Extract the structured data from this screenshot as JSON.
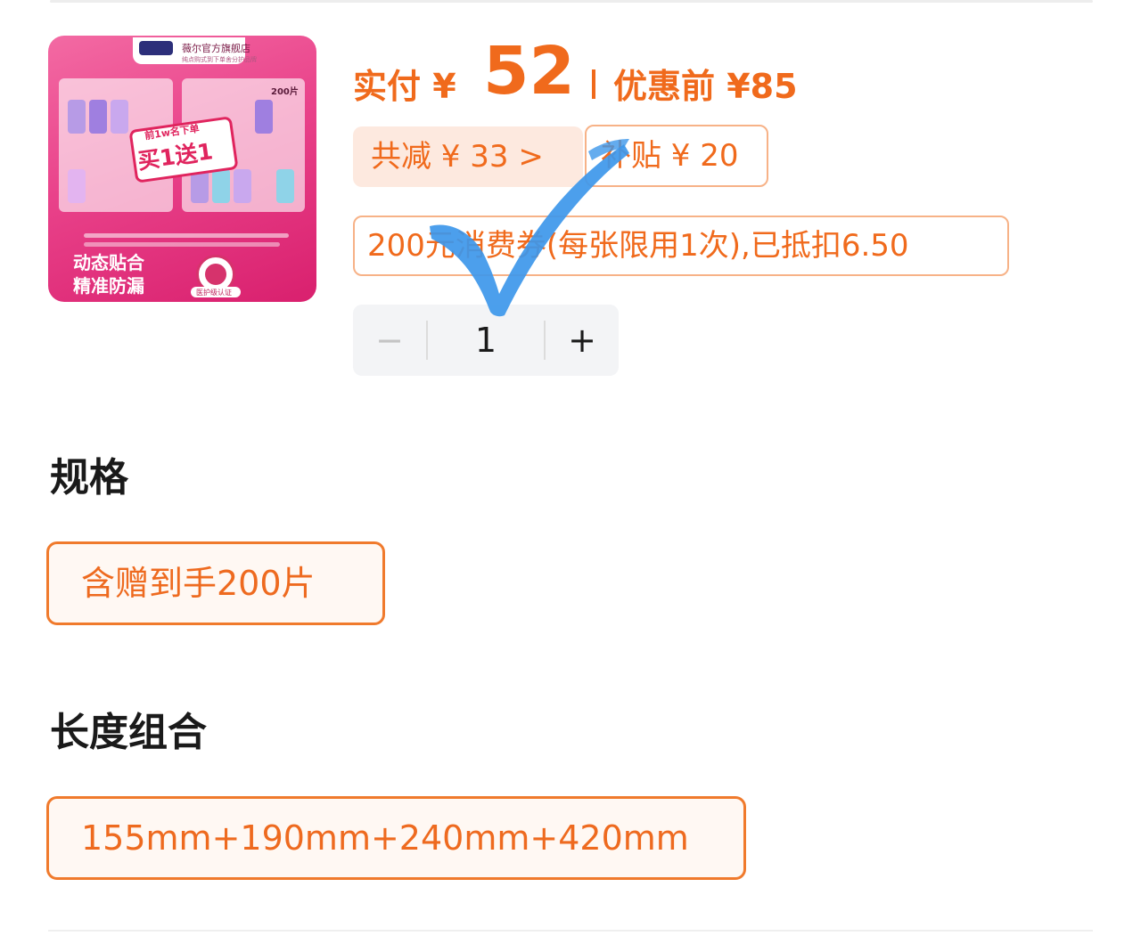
{
  "product": {
    "store_name": "薇尔官方旗舰店",
    "store_sub": "纯点购式到下单舍分护品牌",
    "promo_top": "前1w名下单",
    "promo_main": "买1送1",
    "count_tag": "200片",
    "slogan_line1": "动态贴合",
    "slogan_line2": "精准防漏",
    "seal_text": "医护级认证"
  },
  "price": {
    "paid_label": "实付 ¥",
    "paid_value": "52",
    "original": "优惠前 ¥85"
  },
  "discounts": {
    "total": "共减 ¥ 33 >",
    "subsidy": "补贴 ¥ 20",
    "coupon": "200元消费券(每张限用1次),已抵扣6.50"
  },
  "quantity": {
    "minus": "−",
    "value": "1",
    "plus": "+"
  },
  "spec": {
    "title": "规格",
    "selected": "含赠到手200片"
  },
  "length": {
    "title": "长度组合",
    "selected": "155mm+190mm+240mm+420mm"
  },
  "colors": {
    "accent": "#f06a1c",
    "checkmark": "#3d97ea"
  }
}
